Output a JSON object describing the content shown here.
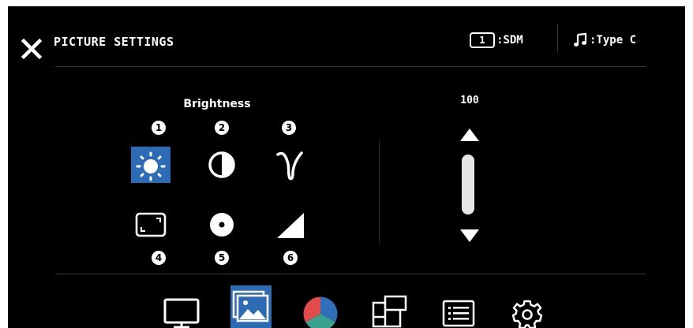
{
  "header": {
    "title": "PICTURE SETTINGS",
    "input_number": "1",
    "input_label": ":SDM",
    "audio_label": ":Type C"
  },
  "picture": {
    "selected_param": "Brightness",
    "value": "100",
    "level": 1.0,
    "params": [
      {
        "num": "1",
        "icon": "brightness-icon",
        "selected": true
      },
      {
        "num": "2",
        "icon": "contrast-icon"
      },
      {
        "num": "3",
        "icon": "gamma-icon"
      },
      {
        "num": "4",
        "icon": "aspect-ratio-icon"
      },
      {
        "num": "5",
        "icon": "point-icon"
      },
      {
        "num": "6",
        "icon": "sharpness-icon"
      }
    ]
  },
  "nav": {
    "items": [
      "monitor-icon",
      "picture-icon",
      "color-icon",
      "multi-window-icon",
      "menu-list-icon",
      "settings-gear-icon"
    ],
    "active": "picture-icon"
  },
  "colors": {
    "accent": "#2d6cb5",
    "background": "#000000",
    "foreground": "#ffffff"
  }
}
